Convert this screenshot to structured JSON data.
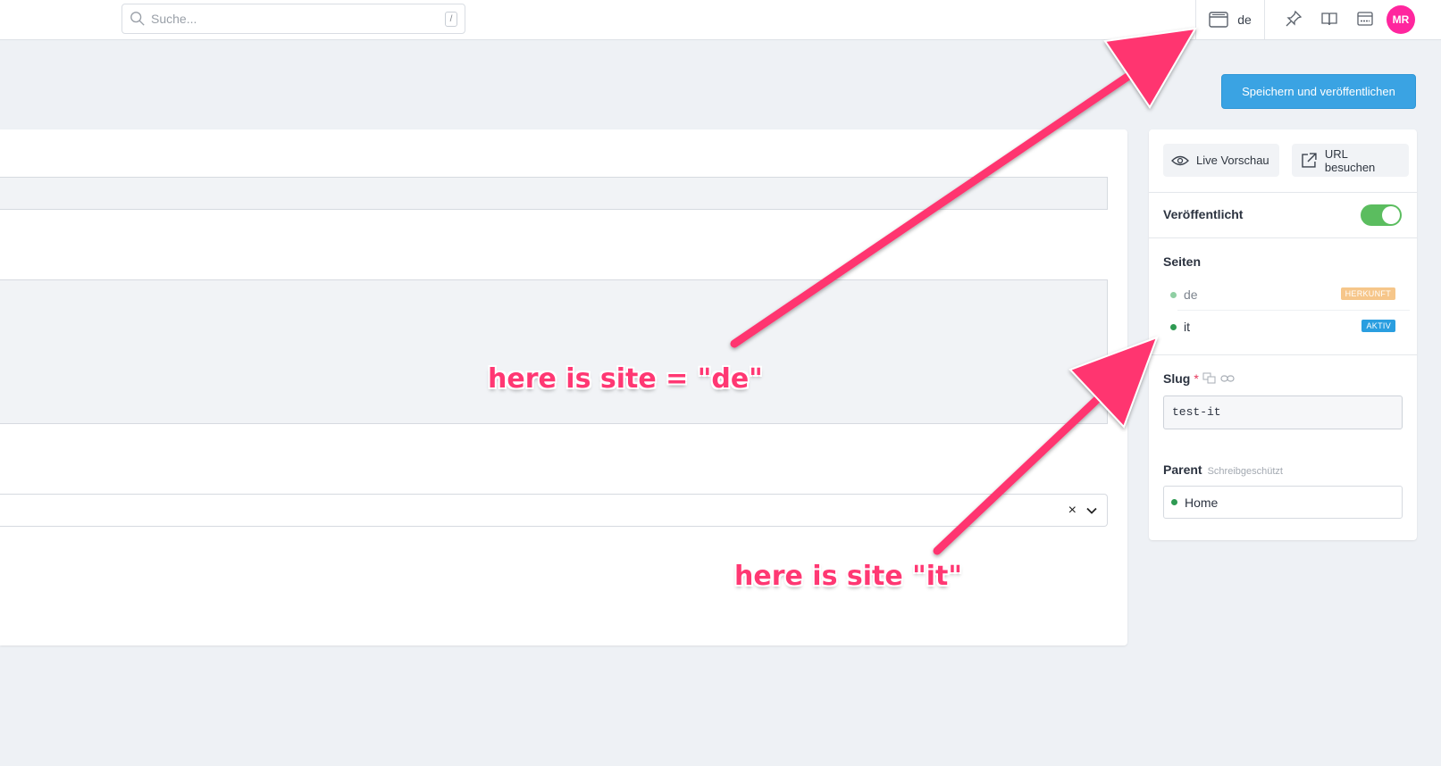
{
  "topbar": {
    "search_placeholder": "Suche...",
    "search_shortcut": "/",
    "current_site": "de",
    "avatar_initials": "MR",
    "avatar_color": "#ff269e"
  },
  "toolbar": {
    "publish_label": "Speichern und veröffentlichen",
    "accent": "#3aa3e3"
  },
  "sidebar": {
    "live_preview_label": "Live Vorschau",
    "visit_url_label": "URL besuchen",
    "published_label": "Veröffentlicht",
    "published_on": true,
    "sites_label": "Seiten",
    "sites": [
      {
        "name": "de",
        "badge": "HERKUNFT",
        "badge_color": "#f6c68a",
        "dot_color": "#8fcfa3"
      },
      {
        "name": "it",
        "badge": "AKTIV",
        "badge_color": "#2a9ee0",
        "dot_color": "#2e9a52"
      }
    ],
    "slug_label": "Slug",
    "slug_required_mark": "*",
    "slug_value": "test-it",
    "parent_label": "Parent",
    "parent_readonly_label": "Schreibgeschützt",
    "parent_value": "Home"
  },
  "main": {
    "select_clear": "×"
  },
  "annotations": {
    "de_note": "here is site = \"de\"",
    "it_note": "here is site \"it\""
  }
}
